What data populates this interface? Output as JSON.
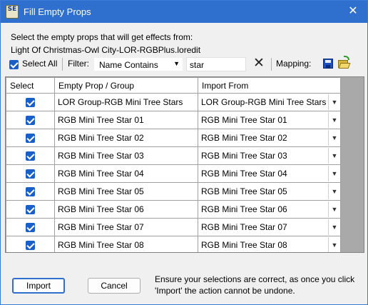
{
  "window": {
    "title": "Fill Empty Props",
    "app_icon_text": "SE",
    "close_icon": "close-icon"
  },
  "intro": {
    "line1": "Select the empty props that will get effects from:",
    "line2": "Light Of Christmas-Owl City-LOR-RGBPlus.loredit"
  },
  "toolbar": {
    "select_all_label": "Select All",
    "select_all_checked": true,
    "filter_label": "Filter:",
    "filter_mode": "Name Contains",
    "filter_text": "star",
    "clear_icon": "close-icon",
    "mapping_label": "Mapping:",
    "save_icon": "save-icon",
    "open_icon": "open-folder-icon"
  },
  "grid": {
    "columns": [
      "Select",
      "Empty Prop / Group",
      "Import From"
    ],
    "rows": [
      {
        "selected": true,
        "prop": "LOR Group-RGB Mini Tree Stars",
        "import_from": "LOR Group-RGB Mini Tree Stars"
      },
      {
        "selected": true,
        "prop": "RGB Mini Tree Star 01",
        "import_from": "RGB Mini Tree Star 01"
      },
      {
        "selected": true,
        "prop": "RGB Mini Tree Star 02",
        "import_from": "RGB Mini Tree Star 02"
      },
      {
        "selected": true,
        "prop": "RGB Mini Tree Star 03",
        "import_from": "RGB Mini Tree Star 03"
      },
      {
        "selected": true,
        "prop": "RGB Mini Tree Star 04",
        "import_from": "RGB Mini Tree Star 04"
      },
      {
        "selected": true,
        "prop": "RGB Mini Tree Star 05",
        "import_from": "RGB Mini Tree Star 05"
      },
      {
        "selected": true,
        "prop": "RGB Mini Tree Star 06",
        "import_from": "RGB Mini Tree Star 06"
      },
      {
        "selected": true,
        "prop": "RGB Mini Tree Star 07",
        "import_from": "RGB Mini Tree Star 07"
      },
      {
        "selected": true,
        "prop": "RGB Mini Tree Star 08",
        "import_from": "RGB Mini Tree Star 08"
      }
    ]
  },
  "footer": {
    "import_label": "Import",
    "cancel_label": "Cancel",
    "warning": "Ensure your selections are correct, as once you click 'Import' the action cannot be undone."
  },
  "colors": {
    "title_bar": "#2f6fce",
    "checkbox": "#1a5fc8",
    "window_bg": "#f0f0f0",
    "grid_empty_bg": "#a9a9a9"
  }
}
